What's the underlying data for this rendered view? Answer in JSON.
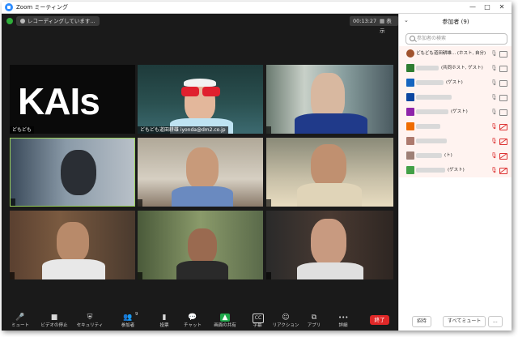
{
  "window": {
    "title": "Zoom ミーティング",
    "min_glyph": "—",
    "max_glyph": "□",
    "close_glyph": "✕"
  },
  "meeting": {
    "recording_text": "レコーディングしています...",
    "timer": "00:13:27",
    "view_label": "表示"
  },
  "tiles": [
    {
      "name": "どもども",
      "logo_text": "KAIs"
    },
    {
      "name": "どもども道田耕雄 iyonda@dm2.co.jp"
    },
    {
      "name": ""
    },
    {
      "name": ""
    },
    {
      "name": ""
    },
    {
      "name": ""
    },
    {
      "name": ""
    },
    {
      "name": ""
    },
    {
      "name": ""
    }
  ],
  "toolbar": {
    "items": [
      {
        "label": "ミュート",
        "icon": "🎤"
      },
      {
        "label": "ビデオの停止",
        "icon": "■"
      },
      {
        "label": "セキュリティ",
        "icon": "⛨"
      },
      {
        "label": "参加者",
        "icon": "👥",
        "count": "9"
      },
      {
        "label": "投票",
        "icon": "▮"
      },
      {
        "label": "チャット",
        "icon": "💬"
      },
      {
        "label": "画面の共有",
        "icon": "▲"
      },
      {
        "label": "字幕",
        "icon": "CC"
      },
      {
        "label": "リアクション",
        "icon": "☺"
      },
      {
        "label": "アプリ",
        "icon": "⧉"
      },
      {
        "label": "詳細",
        "icon": "•••"
      }
    ],
    "end_label": "終了"
  },
  "participants_panel": {
    "title": "参加者 (9)",
    "search_placeholder": "参加者の検索",
    "participants": [
      {
        "name": "どもども道田耕雄... (ホスト, 自分)",
        "avatar_color": "#a0522d",
        "mic_muted": false,
        "video_on": true
      },
      {
        "name": "(共同ホスト, ゲスト)",
        "avatar_color": "#2e7d32",
        "mic_muted": false,
        "video_on": true
      },
      {
        "name": "(ゲスト)",
        "avatar_color": "#1565c0",
        "mic_muted": false,
        "video_on": true
      },
      {
        "name": "",
        "avatar_color": "#0d47a1",
        "mic_muted": false,
        "video_on": true
      },
      {
        "name": "(ゲスト)",
        "avatar_color": "#8e24aa",
        "mic_muted": false,
        "video_on": true
      },
      {
        "name": "",
        "avatar_color": "#ef6c00",
        "mic_muted": true,
        "video_on": true
      },
      {
        "name": "",
        "avatar_color": "#ad7a6e",
        "mic_muted": true,
        "video_on": true
      },
      {
        "name": "(ト)",
        "avatar_color": "#9e8076",
        "mic_muted": true,
        "video_on": true
      },
      {
        "name": "(ゲスト)",
        "avatar_color": "#43a047",
        "mic_muted": true,
        "video_on": true
      }
    ],
    "invite_label": "招待",
    "mute_all_label": "すべてミュート",
    "more_label": "..."
  }
}
